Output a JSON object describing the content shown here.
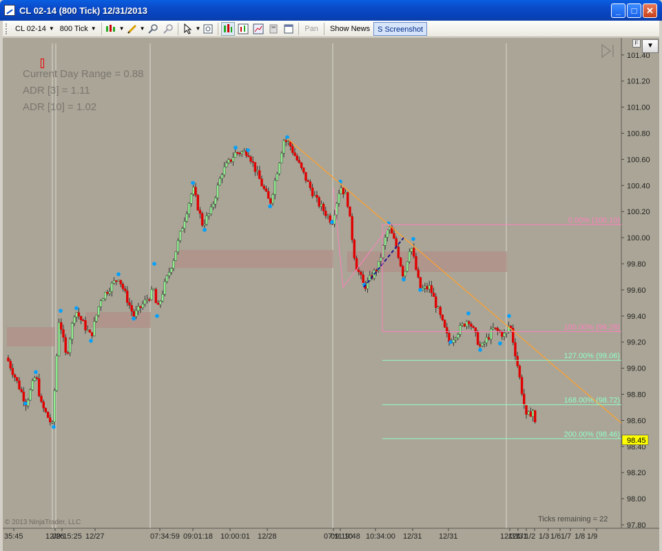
{
  "window": {
    "title": "CL 02-14 (800 Tick)  12/31/2013",
    "minimize": "_",
    "maximize": "□",
    "close": "✕"
  },
  "toolbar": {
    "instrument": "CL 02-14",
    "interval": "800 Tick",
    "pan_label": "Pan",
    "show_news_label": "Show News",
    "screenshot_label": "S Screenshot",
    "icons": [
      "bar-style-icon",
      "drawing-pencil-icon",
      "zoom-in-icon",
      "zoom-out-icon",
      "cursor-icon",
      "magnify-icon",
      "chart-properties-icon",
      "indicators-icon",
      "strategies-icon",
      "data-box-icon",
      "chart-trader-icon"
    ]
  },
  "chart": {
    "info": {
      "line1": "Current Day Range = 0.88",
      "line2": "ADR [3] = 1.11",
      "line3": "ADR [10] = 1.02"
    },
    "copyright": "© 2013 NinjaTrader, LLC",
    "ticks_remaining": "Ticks remaining = 22",
    "f_button": "F",
    "dropdown": "▼",
    "price_labels": [
      "101.40",
      "101.20",
      "101.00",
      "100.80",
      "100.60",
      "100.40",
      "100.20",
      "100.00",
      "99.80",
      "99.60",
      "99.40",
      "99.20",
      "99.00",
      "98.80",
      "98.60",
      "98.40",
      "98.20",
      "98.00",
      "97.80"
    ],
    "last_price": "98.45",
    "time_labels": [
      "35:45",
      "12/26",
      "09:15:25",
      "12/27",
      "07:34:59",
      "09:01:18",
      "10:00:01",
      "12/28",
      "07:11:10",
      "09:19:48",
      "10:34:00",
      "12/31",
      "12/31",
      "12/31",
      "12/31",
      "1/1",
      "1/2",
      "1/3",
      "1/6",
      "1/7",
      "1/8",
      "1/9"
    ],
    "fib_levels": [
      {
        "label": "0.00% (100.10)",
        "price": 100.1,
        "color": "#ff80c0"
      },
      {
        "label": "100.00% (99.28)",
        "price": 99.28,
        "color": "#ff80c0"
      },
      {
        "label": "127.00% (99.06)",
        "price": 99.06,
        "color": "#90ffc8"
      },
      {
        "label": "168.00% (98.72)",
        "price": 98.72,
        "color": "#90ffc8"
      },
      {
        "label": "200.00% (98.46)",
        "price": 98.46,
        "color": "#90ffc8"
      }
    ],
    "colors": {
      "background": "#aaa596",
      "up_candle": "#90ee90",
      "down_candle": "#e00000",
      "swing_dot": "#00a0ff",
      "zone": "#b09088",
      "trendline": "#ffa030",
      "channel": "#1a1a90",
      "last_price_bg": "#ffff00"
    }
  }
}
